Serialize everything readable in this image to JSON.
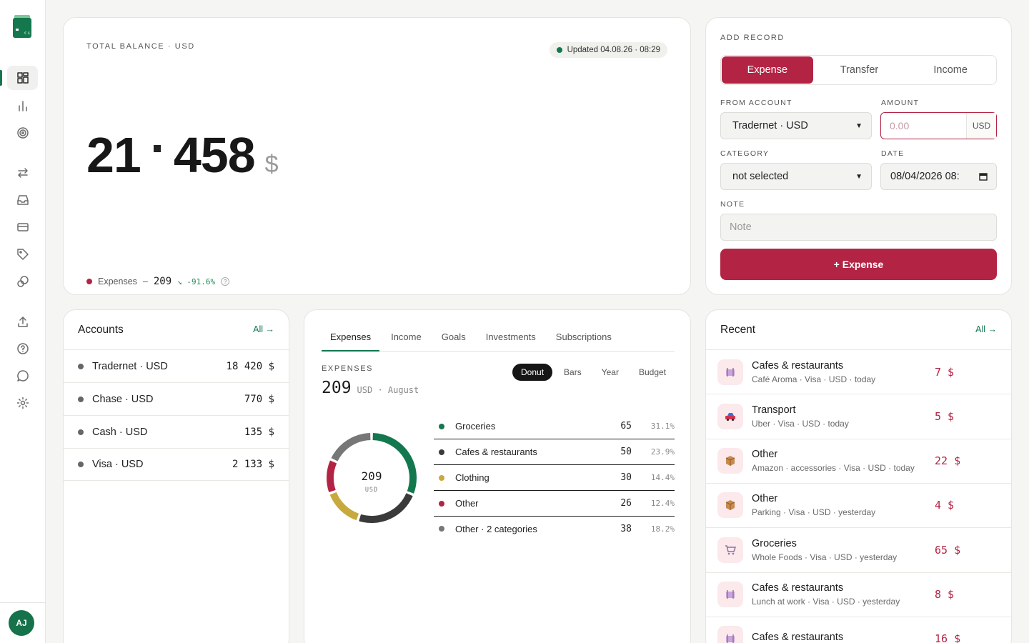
{
  "user": {
    "initials": "AJ"
  },
  "balance": {
    "caption": "TOTAL BALANCE · USD",
    "updated": "Updated 04.08.26 · 08:29",
    "amount_major": "21",
    "amount_minor": "458",
    "currency_symbol": "$",
    "expenses_label": "Expenses",
    "expenses_dash": "–",
    "expenses_value": "209",
    "expenses_change": "↘ -91.6%",
    "help": "?"
  },
  "add_record": {
    "caption": "ADD RECORD",
    "tabs": [
      "Expense",
      "Transfer",
      "Income"
    ],
    "from_account_label": "FROM ACCOUNT",
    "from_account_value": "Tradernet · USD",
    "amount_label": "AMOUNT",
    "amount_placeholder": "0.00",
    "amount_unit": "USD",
    "category_label": "CATEGORY",
    "category_value": "not selected",
    "date_label": "DATE",
    "date_value": "08/04/2026 08:",
    "note_label": "NOTE",
    "note_placeholder": "Note",
    "submit_label": "+ Expense"
  },
  "accounts": {
    "title": "Accounts",
    "all_link": "All →",
    "items": [
      {
        "name": "Tradernet · USD",
        "amount": "18 420 $"
      },
      {
        "name": "Chase · USD",
        "amount": "770 $"
      },
      {
        "name": "Cash · USD",
        "amount": "135 $"
      },
      {
        "name": "Visa · USD",
        "amount": "2 133 $"
      }
    ]
  },
  "expenses": {
    "tabs": [
      "Expenses",
      "Income",
      "Goals",
      "Investments",
      "Subscriptions"
    ],
    "caption": "EXPENSES",
    "total": "209",
    "total_suffix": "USD · August",
    "views": [
      "Donut",
      "Bars",
      "Year",
      "Budget"
    ],
    "donut_center_value": "209",
    "donut_center_unit": "USD"
  },
  "chart_data": {
    "type": "pie",
    "categories": [
      "Groceries",
      "Cafes & restaurants",
      "Clothing",
      "Other",
      "Other · 2 categories"
    ],
    "values": [
      65,
      50,
      30,
      26,
      38
    ],
    "percent_labels": [
      "31.1%",
      "23.9%",
      "14.4%",
      "12.4%",
      "18.2%"
    ],
    "colors": [
      "#14784f",
      "#3a3a3a",
      "#c8a93e",
      "#b32444",
      "#777777"
    ],
    "center_label": "209 USD"
  },
  "recent": {
    "title": "Recent",
    "all_link": "All →",
    "items": [
      {
        "title": "Cafes & restaurants",
        "sub": "Café Aroma · Visa · USD · today",
        "amount": "7 $",
        "icon": "plate-icon"
      },
      {
        "title": "Transport",
        "sub": "Uber · Visa · USD · today",
        "amount": "5 $",
        "icon": "car-icon"
      },
      {
        "title": "Other",
        "sub": "Amazon · accessories · Visa · USD · today",
        "amount": "22 $",
        "icon": "box-icon"
      },
      {
        "title": "Other",
        "sub": "Parking · Visa · USD · yesterday",
        "amount": "4 $",
        "icon": "box-icon"
      },
      {
        "title": "Groceries",
        "sub": "Whole Foods · Visa · USD · yesterday",
        "amount": "65 $",
        "icon": "cart-icon"
      },
      {
        "title": "Cafes & restaurants",
        "sub": "Lunch at work · Visa · USD · yesterday",
        "amount": "8 $",
        "icon": "plate-icon"
      },
      {
        "title": "Cafes & restaurants",
        "sub": "",
        "amount": "16 $",
        "icon": "plate-icon"
      }
    ]
  }
}
